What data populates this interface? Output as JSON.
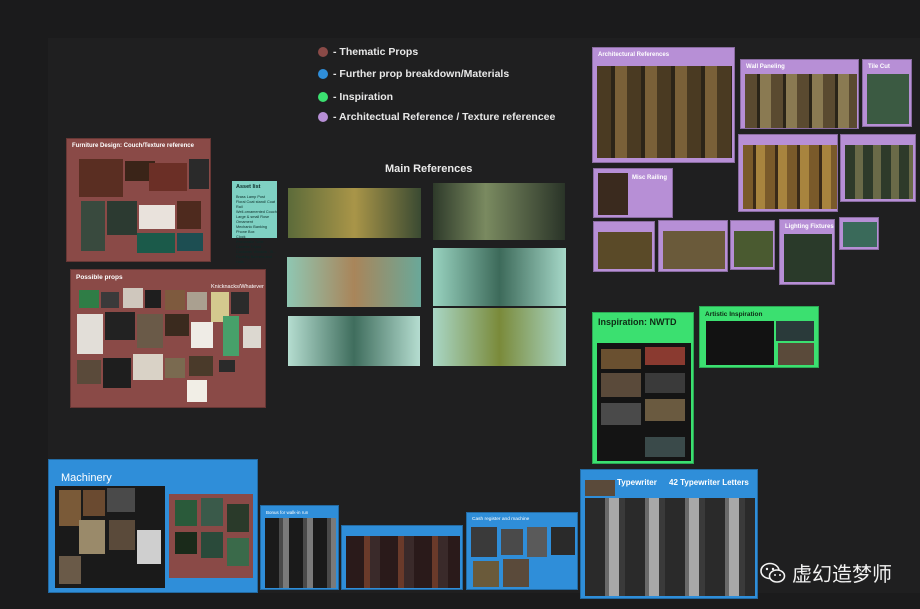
{
  "legend": [
    {
      "label": "- Thematic Props",
      "color": "#8a4a47"
    },
    {
      "label": "- Further prop breakdown/Materials",
      "color": "#2f8ed9"
    },
    {
      "label": "- Inspiration",
      "color": "#3be070"
    },
    {
      "label": "- Architectual Reference / Texture referencee",
      "color": "#b78fd6"
    }
  ],
  "main_references": {
    "title": "Main References"
  },
  "asset_list": {
    "title": "Asset list",
    "body": "Brass Lamp Post\nFloral Coat stand/ Coat Rail\nWell-ornamented Couch\nLarge & small Rose Ornament\nMechanic Banking\nPhone Box\nClock\nPneumatic Tube\nCamera Tripod\nCustomer Window - B…\nFloating Bonnets and Hats"
  },
  "groups": {
    "furniture": {
      "title": "Furniture Design: Couch/Texture reference"
    },
    "possible_props": {
      "title": "Possible props",
      "subtitle": "Knicknacks/Whatever"
    },
    "machinery": {
      "title": "Machinery"
    },
    "blue_small": {
      "title": "Bonus for walk-in run"
    },
    "blue_cash": {
      "title": "Cash register and machine"
    },
    "typewriter": {
      "title": "Typewriter",
      "subtitle": "42 Typewriter Letters"
    },
    "nwtd": {
      "title": "Inspiration: NWTD"
    },
    "artistic": {
      "title": "Artistic Inspiration"
    },
    "arch": {
      "title": "Architectural References"
    },
    "wall": {
      "title": "Wall Paneling"
    },
    "tile": {
      "title": "Tile Cut"
    },
    "misc_railing": {
      "title": "Misc Railing"
    },
    "lighting": {
      "title": "Lighting Fixtures"
    }
  },
  "watermark": {
    "text": "虚幻造梦师"
  },
  "colors": {
    "thematic": "#8a4a47",
    "prop_breakdown": "#2f8ed9",
    "inspiration": "#3be070",
    "arch": "#b78fd6",
    "asset_card": "#7fd1c3"
  }
}
